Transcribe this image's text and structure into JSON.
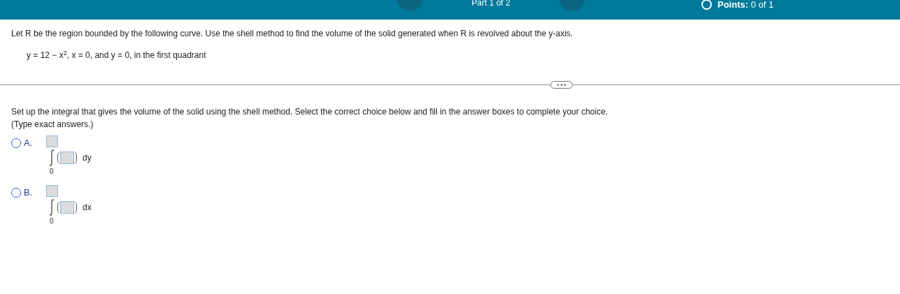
{
  "header": {
    "part": "Part 1 of 2",
    "points_label": "Points:",
    "points_value": "0 of 1"
  },
  "question": {
    "prompt": "Let R be the region bounded by the following curve. Use the shell method to find the volume of the solid generated when R is revolved about the y-axis.",
    "equation": "y = 12 − x$^{2}$, x = 0, and y = 0, in the first quadrant"
  },
  "instruction": "Set up the integral that gives the volume of the solid using the shell method. Select the correct choice below and fill in the answer boxes to complete your choice.",
  "hint": "(Type exact answers.)",
  "choices": [
    {
      "letter": "A.",
      "selected": false,
      "lower_limit": "0",
      "differential": "dy"
    },
    {
      "letter": "B.",
      "selected": false,
      "lower_limit": "0",
      "differential": "dx"
    }
  ]
}
